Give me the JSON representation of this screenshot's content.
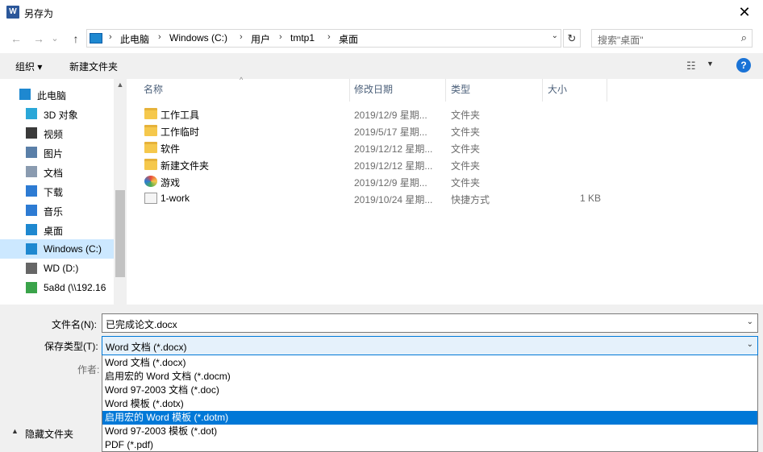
{
  "window": {
    "title": "另存为",
    "app_icon_letter": "W",
    "close_glyph": "✕"
  },
  "nav": {
    "back_glyph": "←",
    "forward_glyph": "→",
    "history_glyph": "⌄",
    "up_glyph": "↑",
    "breadcrumb": [
      "此电脑",
      "Windows (C:)",
      "用户",
      "tmtp1",
      "桌面"
    ],
    "separator": "›",
    "refresh_glyph": "↻",
    "search_placeholder": "搜索\"桌面\"",
    "search_glyph": "⌕"
  },
  "toolbar": {
    "organize_label": "组织 ▾",
    "new_folder_label": "新建文件夹",
    "view_glyph": "☷",
    "view_dropdown_glyph": "▼",
    "help_label": "?"
  },
  "sidebar": {
    "items": [
      {
        "label": "此电脑",
        "icon": "computer-icon",
        "color": "#1e88d0"
      },
      {
        "label": "3D 对象",
        "icon": "cube-icon",
        "color": "#2aa7d8"
      },
      {
        "label": "视频",
        "icon": "film-icon",
        "color": "#3a3a3a"
      },
      {
        "label": "图片",
        "icon": "picture-icon",
        "color": "#5a7fa8"
      },
      {
        "label": "文档",
        "icon": "document-icon",
        "color": "#8a9bb0"
      },
      {
        "label": "下载",
        "icon": "download-icon",
        "color": "#2d7bd3"
      },
      {
        "label": "音乐",
        "icon": "music-icon",
        "color": "#2d7bd3"
      },
      {
        "label": "桌面",
        "icon": "desktop-icon",
        "color": "#1e88d0"
      },
      {
        "label": "Windows (C:)",
        "icon": "drive-icon",
        "color": "#1e88d0"
      },
      {
        "label": "WD (D:)",
        "icon": "drive-icon",
        "color": "#666666"
      },
      {
        "label": "5a8d (\\\\192.16",
        "icon": "network-drive-icon",
        "color": "#3aa34a"
      }
    ],
    "selected_index": 8,
    "scroll_up_glyph": "▲"
  },
  "columns": {
    "name": "名称",
    "date": "修改日期",
    "type": "类型",
    "size": "大小",
    "sort_glyph": "^"
  },
  "files": [
    {
      "name": "工作工具",
      "date": "2019/12/9 星期...",
      "type": "文件夹",
      "size": "",
      "icon": "warning-folder-icon"
    },
    {
      "name": "工作临时",
      "date": "2019/5/17 星期...",
      "type": "文件夹",
      "size": "",
      "icon": "warning-icon"
    },
    {
      "name": "软件",
      "date": "2019/12/12 星期...",
      "type": "文件夹",
      "size": "",
      "icon": "folder-icon"
    },
    {
      "name": "新建文件夹",
      "date": "2019/12/12 星期...",
      "type": "文件夹",
      "size": "",
      "icon": "folder-icon"
    },
    {
      "name": "游戏",
      "date": "2019/12/9 星期...",
      "type": "文件夹",
      "size": "",
      "icon": "games-folder-icon"
    },
    {
      "name": "1-work",
      "date": "2019/10/24 星期...",
      "type": "快捷方式",
      "size": "1 KB",
      "icon": "shortcut-icon"
    }
  ],
  "form": {
    "filename_label": "文件名(N):",
    "filename_value": "已完成论文.docx",
    "filetype_label": "保存类型(T):",
    "filetype_value": "Word 文档 (*.docx)",
    "author_label": "作者:",
    "dropdown_glyph": "⌄",
    "hide_folders_label": "隐藏文件夹",
    "hide_folders_glyph": "▲"
  },
  "filetype_options": [
    "Word 文档 (*.docx)",
    "启用宏的 Word 文档 (*.docm)",
    "Word 97-2003 文档 (*.doc)",
    "Word 模板 (*.dotx)",
    "启用宏的 Word 模板 (*.dotm)",
    "Word 97-2003 模板 (*.dot)",
    "PDF (*.pdf)"
  ],
  "filetype_selected_index": 4
}
